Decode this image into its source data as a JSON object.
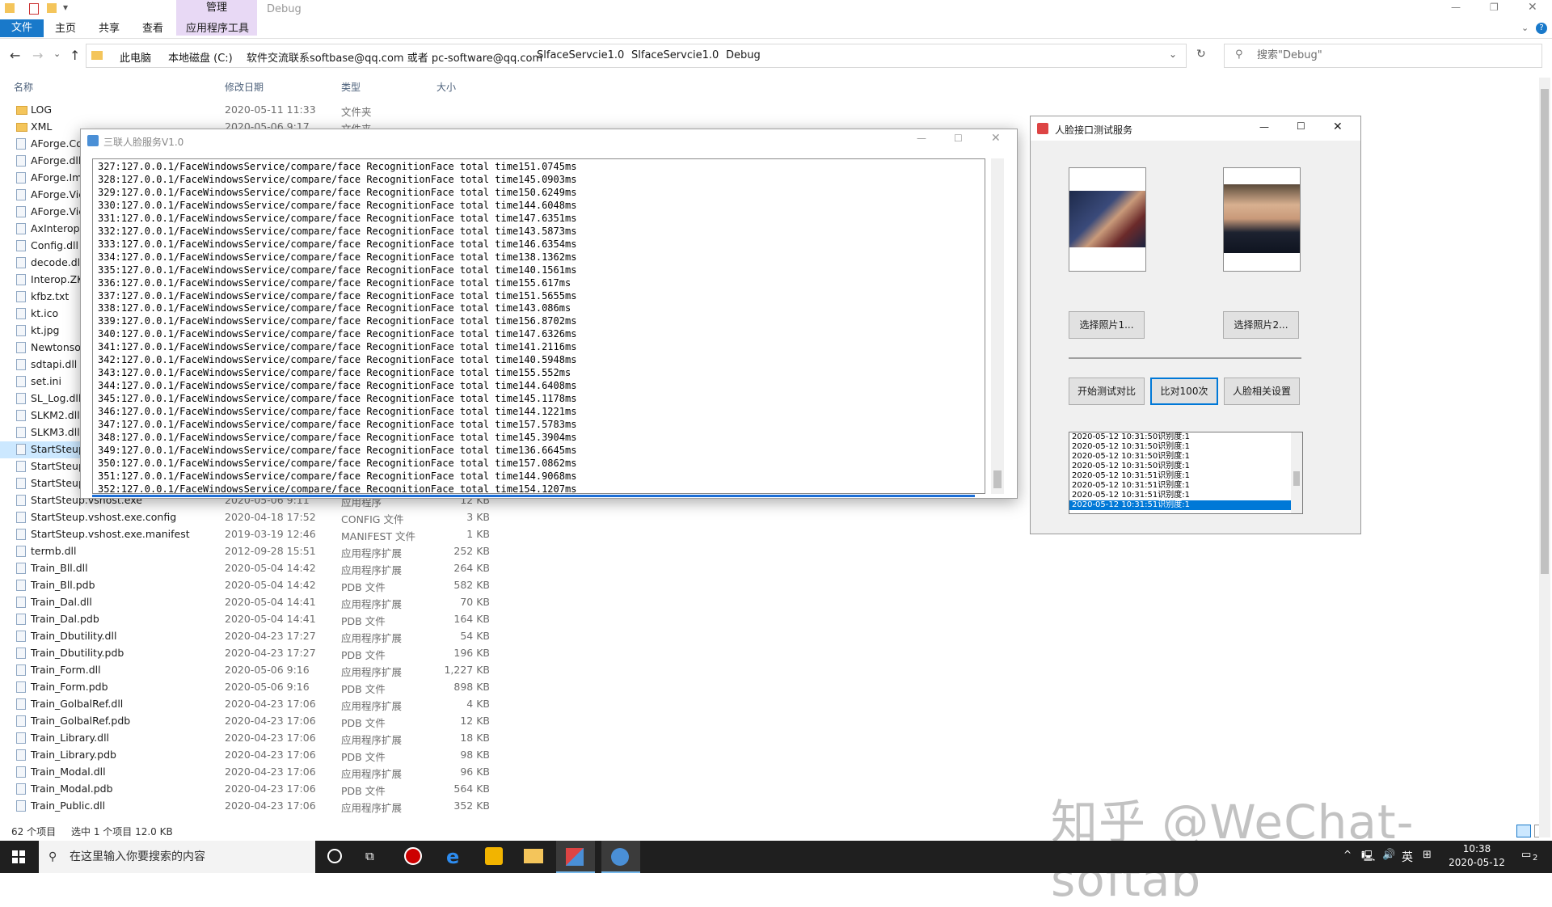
{
  "explorer": {
    "context_tab": "管理",
    "window_title": "Debug",
    "tabs": [
      "文件",
      "主页",
      "共享",
      "查看",
      "应用程序工具"
    ],
    "breadcrumb": [
      "此电脑",
      "本地磁盘 (C:)",
      "软件交流联系softbase@qq.com 或者 pc-software@qq.com",
      "SlfaceServcie1.0",
      "SlfaceServcie1.0",
      "Debug"
    ],
    "search_placeholder": "搜索\"Debug\"",
    "columns": [
      "名称",
      "修改日期",
      "类型",
      "大小"
    ],
    "files": [
      {
        "name": "LOG",
        "date": "2020-05-11 11:33",
        "type": "文件夹",
        "size": "",
        "folder": true
      },
      {
        "name": "XML",
        "date": "2020-05-06 9:17",
        "type": "文件夹",
        "size": "",
        "folder": true
      },
      {
        "name": "AForge.Co",
        "date": "",
        "type": "",
        "size": ""
      },
      {
        "name": "AForge.dll",
        "date": "",
        "type": "",
        "size": ""
      },
      {
        "name": "AForge.Im",
        "date": "",
        "type": "",
        "size": ""
      },
      {
        "name": "AForge.Vic",
        "date": "",
        "type": "",
        "size": ""
      },
      {
        "name": "AForge.Vic",
        "date": "",
        "type": "",
        "size": ""
      },
      {
        "name": "AxInterop.",
        "date": "",
        "type": "",
        "size": ""
      },
      {
        "name": "Config.dll",
        "date": "",
        "type": "",
        "size": ""
      },
      {
        "name": "decode.dll",
        "date": "",
        "type": "",
        "size": ""
      },
      {
        "name": "Interop.ZK",
        "date": "",
        "type": "",
        "size": ""
      },
      {
        "name": "kfbz.txt",
        "date": "",
        "type": "",
        "size": ""
      },
      {
        "name": "kt.ico",
        "date": "",
        "type": "",
        "size": ""
      },
      {
        "name": "kt.jpg",
        "date": "",
        "type": "",
        "size": ""
      },
      {
        "name": "Newtonsof",
        "date": "",
        "type": "",
        "size": ""
      },
      {
        "name": "sdtapi.dll",
        "date": "",
        "type": "",
        "size": ""
      },
      {
        "name": "set.ini",
        "date": "",
        "type": "",
        "size": ""
      },
      {
        "name": "SL_Log.dll",
        "date": "",
        "type": "",
        "size": ""
      },
      {
        "name": "SLKM2.dll",
        "date": "",
        "type": "",
        "size": ""
      },
      {
        "name": "SLKM3.dll",
        "date": "",
        "type": "",
        "size": ""
      },
      {
        "name": "StartSteup",
        "date": "",
        "type": "",
        "size": "",
        "selected": true
      },
      {
        "name": "StartSteup",
        "date": "",
        "type": "",
        "size": ""
      },
      {
        "name": "StartSteup",
        "date": "",
        "type": "",
        "size": ""
      },
      {
        "name": "StartSteup.vshost.exe",
        "date": "2020-05-06 9:11",
        "type": "应用程序",
        "size": "12 KB"
      },
      {
        "name": "StartSteup.vshost.exe.config",
        "date": "2020-04-18 17:52",
        "type": "CONFIG 文件",
        "size": "3 KB"
      },
      {
        "name": "StartSteup.vshost.exe.manifest",
        "date": "2019-03-19 12:46",
        "type": "MANIFEST 文件",
        "size": "1 KB"
      },
      {
        "name": "termb.dll",
        "date": "2012-09-28 15:51",
        "type": "应用程序扩展",
        "size": "252 KB"
      },
      {
        "name": "Train_Bll.dll",
        "date": "2020-05-04 14:42",
        "type": "应用程序扩展",
        "size": "264 KB"
      },
      {
        "name": "Train_Bll.pdb",
        "date": "2020-05-04 14:42",
        "type": "PDB 文件",
        "size": "582 KB"
      },
      {
        "name": "Train_Dal.dll",
        "date": "2020-05-04 14:41",
        "type": "应用程序扩展",
        "size": "70 KB"
      },
      {
        "name": "Train_Dal.pdb",
        "date": "2020-05-04 14:41",
        "type": "PDB 文件",
        "size": "164 KB"
      },
      {
        "name": "Train_Dbutility.dll",
        "date": "2020-04-23 17:27",
        "type": "应用程序扩展",
        "size": "54 KB"
      },
      {
        "name": "Train_Dbutility.pdb",
        "date": "2020-04-23 17:27",
        "type": "PDB 文件",
        "size": "196 KB"
      },
      {
        "name": "Train_Form.dll",
        "date": "2020-05-06 9:16",
        "type": "应用程序扩展",
        "size": "1,227 KB"
      },
      {
        "name": "Train_Form.pdb",
        "date": "2020-05-06 9:16",
        "type": "PDB 文件",
        "size": "898 KB"
      },
      {
        "name": "Train_GolbalRef.dll",
        "date": "2020-04-23 17:06",
        "type": "应用程序扩展",
        "size": "4 KB"
      },
      {
        "name": "Train_GolbalRef.pdb",
        "date": "2020-04-23 17:06",
        "type": "PDB 文件",
        "size": "12 KB"
      },
      {
        "name": "Train_Library.dll",
        "date": "2020-04-23 17:06",
        "type": "应用程序扩展",
        "size": "18 KB"
      },
      {
        "name": "Train_Library.pdb",
        "date": "2020-04-23 17:06",
        "type": "PDB 文件",
        "size": "98 KB"
      },
      {
        "name": "Train_Modal.dll",
        "date": "2020-04-23 17:06",
        "type": "应用程序扩展",
        "size": "96 KB"
      },
      {
        "name": "Train_Modal.pdb",
        "date": "2020-04-23 17:06",
        "type": "PDB 文件",
        "size": "564 KB"
      },
      {
        "name": "Train_Public.dll",
        "date": "2020-04-23 17:06",
        "type": "应用程序扩展",
        "size": "352 KB"
      }
    ],
    "status_count": "62 个项目",
    "status_selection": "选中 1 个项目  12.0 KB"
  },
  "console": {
    "title": "三联人脸服务V1.0",
    "log_lines": [
      "327:127.0.0.1/FaceWindowsService/compare/face RecognitionFace total time151.0745ms",
      "328:127.0.0.1/FaceWindowsService/compare/face RecognitionFace total time145.0903ms",
      "329:127.0.0.1/FaceWindowsService/compare/face RecognitionFace total time150.6249ms",
      "330:127.0.0.1/FaceWindowsService/compare/face RecognitionFace total time144.6048ms",
      "331:127.0.0.1/FaceWindowsService/compare/face RecognitionFace total time147.6351ms",
      "332:127.0.0.1/FaceWindowsService/compare/face RecognitionFace total time143.5873ms",
      "333:127.0.0.1/FaceWindowsService/compare/face RecognitionFace total time146.6354ms",
      "334:127.0.0.1/FaceWindowsService/compare/face RecognitionFace total time138.1362ms",
      "335:127.0.0.1/FaceWindowsService/compare/face RecognitionFace total time140.1561ms",
      "336:127.0.0.1/FaceWindowsService/compare/face RecognitionFace total time155.617ms",
      "337:127.0.0.1/FaceWindowsService/compare/face RecognitionFace total time151.5655ms",
      "338:127.0.0.1/FaceWindowsService/compare/face RecognitionFace total time143.086ms",
      "339:127.0.0.1/FaceWindowsService/compare/face RecognitionFace total time156.8702ms",
      "340:127.0.0.1/FaceWindowsService/compare/face RecognitionFace total time147.6326ms",
      "341:127.0.0.1/FaceWindowsService/compare/face RecognitionFace total time141.2116ms",
      "342:127.0.0.1/FaceWindowsService/compare/face RecognitionFace total time140.5948ms",
      "343:127.0.0.1/FaceWindowsService/compare/face RecognitionFace total time155.552ms",
      "344:127.0.0.1/FaceWindowsService/compare/face RecognitionFace total time144.6408ms",
      "345:127.0.0.1/FaceWindowsService/compare/face RecognitionFace total time145.1178ms",
      "346:127.0.0.1/FaceWindowsService/compare/face RecognitionFace total time144.1221ms",
      "347:127.0.0.1/FaceWindowsService/compare/face RecognitionFace total time157.5783ms",
      "348:127.0.0.1/FaceWindowsService/compare/face RecognitionFace total time145.3904ms",
      "349:127.0.0.1/FaceWindowsService/compare/face RecognitionFace total time136.6645ms",
      "350:127.0.0.1/FaceWindowsService/compare/face RecognitionFace total time157.0862ms",
      "351:127.0.0.1/FaceWindowsService/compare/face RecognitionFace total time144.9068ms",
      "352:127.0.0.1/FaceWindowsService/compare/face RecognitionFace total time154.1207ms"
    ]
  },
  "facetest": {
    "title": "人脸接口测试服务",
    "select_photo1": "选择照片1...",
    "select_photo2": "选择照片2...",
    "start_compare": "开始测试对比",
    "compare_100": "比对100次",
    "face_settings": "人脸相关设置",
    "results": [
      "2020-05-12 10:31:50识别度:1",
      "2020-05-12 10:31:50识别度:1",
      "2020-05-12 10:31:50识别度:1",
      "2020-05-12 10:31:50识别度:1",
      "2020-05-12 10:31:51识别度:1",
      "2020-05-12 10:31:51识别度:1",
      "2020-05-12 10:31:51识别度:1",
      "2020-05-12 10:31:51识别度:1"
    ]
  },
  "taskbar": {
    "search_placeholder": "在这里输入你要搜索的内容",
    "ime": "英",
    "time": "10:38",
    "date": "2020-05-12",
    "notifications": "2"
  },
  "watermark": "知乎 @WeChat-softab",
  "colors": {
    "accent": "#0078d7",
    "file_tab": "#1979ca",
    "manage_tab": "#e8d9f5"
  }
}
